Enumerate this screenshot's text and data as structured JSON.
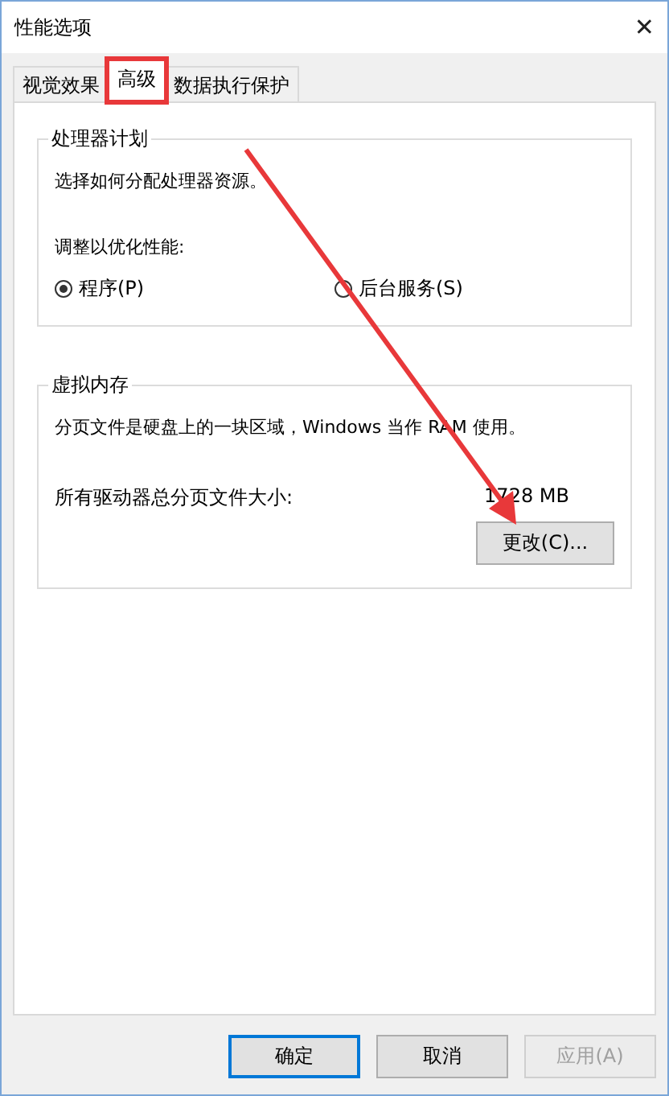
{
  "window": {
    "title": "性能选项",
    "close": "✕"
  },
  "tabs": [
    {
      "label": "视觉效果",
      "selected": false,
      "highlighted": false
    },
    {
      "label": "高级",
      "selected": true,
      "highlighted": true
    },
    {
      "label": "数据执行保护",
      "selected": false,
      "highlighted": false
    }
  ],
  "processor_group": {
    "title": "处理器计划",
    "description": "选择如何分配处理器资源。",
    "prompt": "调整以优化性能:",
    "options": [
      {
        "label": "程序(P)",
        "selected": true
      },
      {
        "label": "后台服务(S)",
        "selected": false
      }
    ]
  },
  "memory_group": {
    "title": "虚拟内存",
    "description": "分页文件是硬盘上的一块区域，Windows 当作 RAM 使用。",
    "size_label": "所有驱动器总分页文件大小:",
    "size_value": "1728 MB",
    "button": "更改(C)..."
  },
  "buttons": [
    {
      "label": "确定",
      "default": true,
      "disabled": false
    },
    {
      "label": "取消",
      "default": false,
      "disabled": false
    },
    {
      "label": "应用(A)",
      "default": false,
      "disabled": true
    }
  ]
}
